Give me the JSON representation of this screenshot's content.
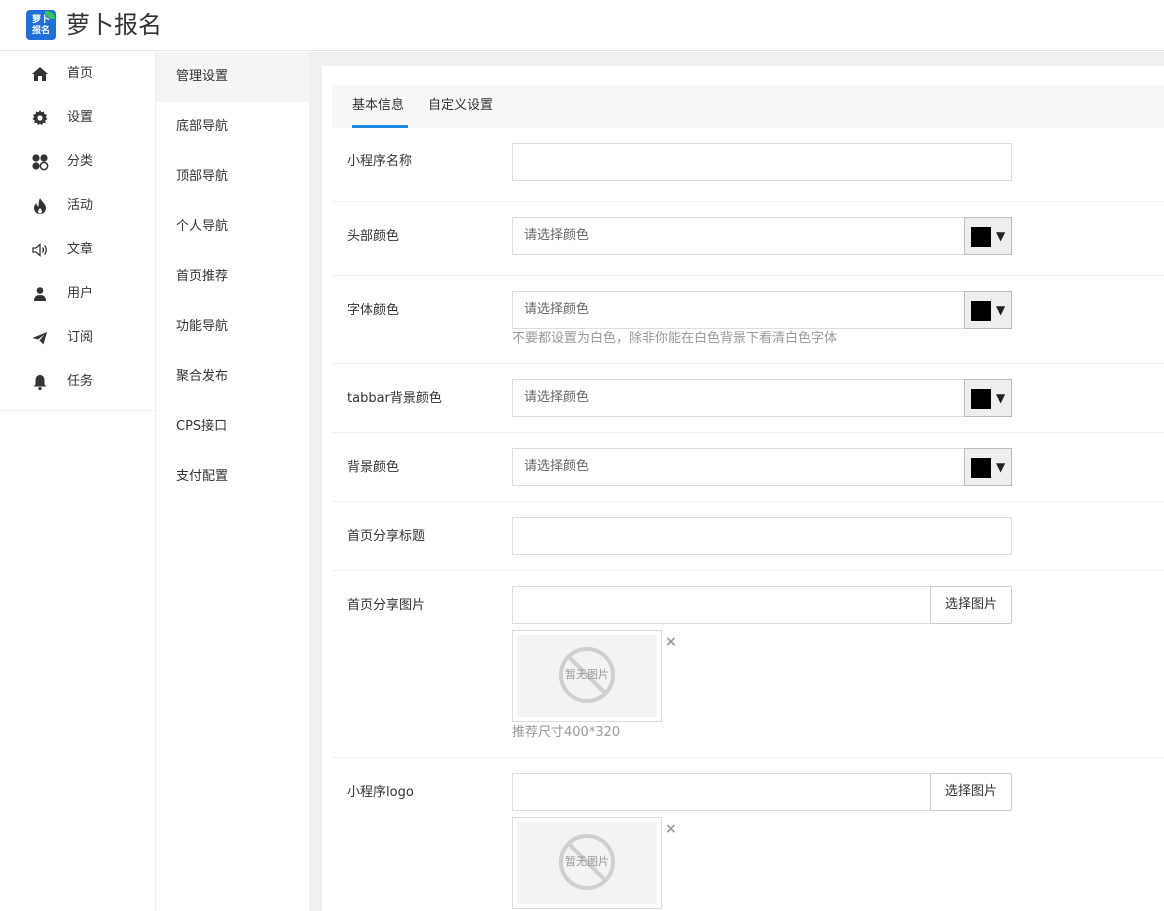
{
  "app": {
    "logo_line1": "萝卜",
    "logo_line2": "报名",
    "title": "萝卜报名"
  },
  "sidebar": {
    "items": [
      {
        "label": "首页",
        "icon": "home-icon"
      },
      {
        "label": "设置",
        "icon": "gear-icon"
      },
      {
        "label": "分类",
        "icon": "grid-icon"
      },
      {
        "label": "活动",
        "icon": "fire-icon"
      },
      {
        "label": "文章",
        "icon": "speaker-icon"
      },
      {
        "label": "用户",
        "icon": "user-icon"
      },
      {
        "label": "订阅",
        "icon": "send-icon"
      },
      {
        "label": "任务",
        "icon": "bell-icon"
      }
    ]
  },
  "submenu": {
    "items": [
      {
        "label": "管理设置",
        "active": true
      },
      {
        "label": "底部导航"
      },
      {
        "label": "顶部导航"
      },
      {
        "label": "个人导航"
      },
      {
        "label": "首页推荐"
      },
      {
        "label": "功能导航"
      },
      {
        "label": "聚合发布"
      },
      {
        "label": "CPS接口"
      },
      {
        "label": "支付配置"
      }
    ]
  },
  "tabs": [
    {
      "label": "基本信息",
      "active": true
    },
    {
      "label": "自定义设置"
    }
  ],
  "form": {
    "mini_name": {
      "label": "小程序名称",
      "value": ""
    },
    "header_color": {
      "label": "头部颜色",
      "placeholder": "请选择颜色",
      "swatch": "#000000"
    },
    "font_color": {
      "label": "字体颜色",
      "placeholder": "请选择颜色",
      "swatch": "#000000",
      "hint": "不要都设置为白色，除非你能在白色背景下看清白色字体"
    },
    "tabbar_color": {
      "label": "tabbar背景颜色",
      "placeholder": "请选择颜色",
      "swatch": "#000000"
    },
    "bg_color": {
      "label": "背景颜色",
      "placeholder": "请选择颜色",
      "swatch": "#000000"
    },
    "share_title": {
      "label": "首页分享标题",
      "value": ""
    },
    "share_image": {
      "label": "首页分享图片",
      "button": "选择图片",
      "no_image": "暂无图片",
      "hint": "推荐尺寸400*320"
    },
    "logo": {
      "label": "小程序logo",
      "button": "选择图片",
      "no_image": "暂无图片"
    }
  },
  "symbols": {
    "dropdown_arrow": "▼",
    "remove": "×"
  },
  "colors": {
    "accent": "#1e88e5",
    "logo_bg": "#1e6fd9"
  }
}
